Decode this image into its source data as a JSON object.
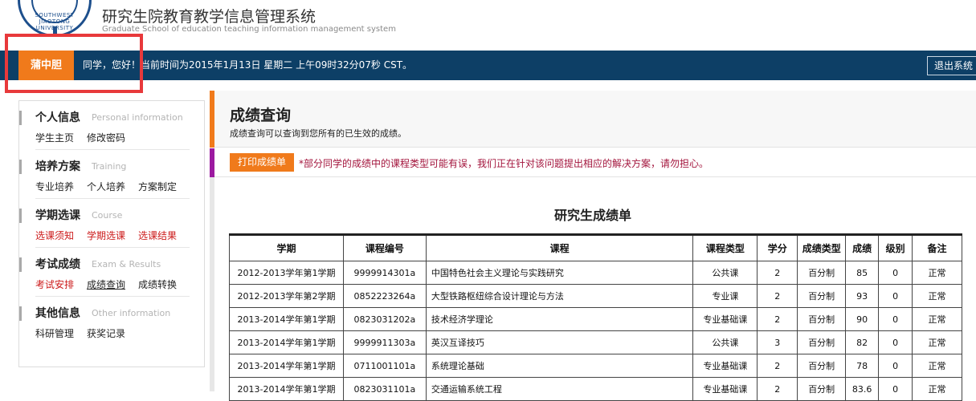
{
  "header": {
    "logo_ring_text": "SOUTHWEST JIAOTONG UNIVERSITY",
    "title": "研究生院教育教学信息管理系统",
    "subtitle": "Graduate School of education teaching information management system"
  },
  "navbar": {
    "user_name": "蒲中胆",
    "welcome": "同学，您好！当前时间为2015年1月13日 星期二 上午09时32分07秒 CST。",
    "logout": "退出系统"
  },
  "sidebar": {
    "groups": [
      {
        "cn": "个人信息",
        "en": "Personal information",
        "links": [
          {
            "label": "学生主页",
            "style": "dark"
          },
          {
            "label": "修改密码",
            "style": "dark"
          }
        ]
      },
      {
        "cn": "培养方案",
        "en": "Training",
        "links": [
          {
            "label": "专业培养",
            "style": "dark"
          },
          {
            "label": "个人培养",
            "style": "dark"
          },
          {
            "label": "方案制定",
            "style": "dark"
          }
        ]
      },
      {
        "cn": "学期选课",
        "en": "Course",
        "links": [
          {
            "label": "选课须知",
            "style": "red"
          },
          {
            "label": "学期选课",
            "style": "red"
          },
          {
            "label": "选课结果",
            "style": "red"
          }
        ]
      },
      {
        "cn": "考试成绩",
        "en": "Exam & Results",
        "links": [
          {
            "label": "考试安排",
            "style": "red"
          },
          {
            "label": "成绩查询",
            "style": "active"
          },
          {
            "label": "成绩转换",
            "style": "dark"
          }
        ]
      },
      {
        "cn": "其他信息",
        "en": "Other information",
        "links": [
          {
            "label": "科研管理",
            "style": "dark"
          },
          {
            "label": "获奖记录",
            "style": "dark"
          }
        ]
      }
    ]
  },
  "main": {
    "title": "成绩查询",
    "description": "成绩查询可以查询到您所有的已生效的成绩。",
    "print_button": "打印成绩单",
    "notice": "*部分同学的成绩中的课程类型可能有误，我们正在针对该问题提出相应的解决方案，请勿担心。",
    "report_title": "研究生成绩单"
  },
  "table": {
    "headers": [
      "学期",
      "课程编号",
      "课程",
      "课程类型",
      "学分",
      "成绩类型",
      "成绩",
      "级别",
      "备注"
    ],
    "rows": [
      [
        "2012-2013学年第1学期",
        "9999914301a",
        "中国特色社会主义理论与实践研究",
        "公共课",
        "2",
        "百分制",
        "85",
        "0",
        "正常"
      ],
      [
        "2012-2013学年第2学期",
        "0852223264a",
        "大型铁路枢纽综合设计理论与方法",
        "专业课",
        "2",
        "百分制",
        "93",
        "0",
        "正常"
      ],
      [
        "2013-2014学年第1学期",
        "0823031202a",
        "技术经济学理论",
        "专业基础课",
        "2",
        "百分制",
        "90",
        "0",
        "正常"
      ],
      [
        "2013-2014学年第1学期",
        "9999911303a",
        "英汉互译技巧",
        "公共课",
        "3",
        "百分制",
        "82",
        "0",
        "正常"
      ],
      [
        "2013-2014学年第1学期",
        "0711001101a",
        "系统理论基础",
        "专业基础课",
        "2",
        "百分制",
        "78",
        "0",
        "正常"
      ],
      [
        "2013-2014学年第1学期",
        "0823031101a",
        "交通运输系统工程",
        "专业基础课",
        "2",
        "百分制",
        "83.6",
        "0",
        "正常"
      ]
    ]
  },
  "colors": {
    "navbar": "#0d3f66",
    "accent_orange": "#f07a1b",
    "notice_red": "#a3143c",
    "highlight_red": "#e8393b"
  }
}
